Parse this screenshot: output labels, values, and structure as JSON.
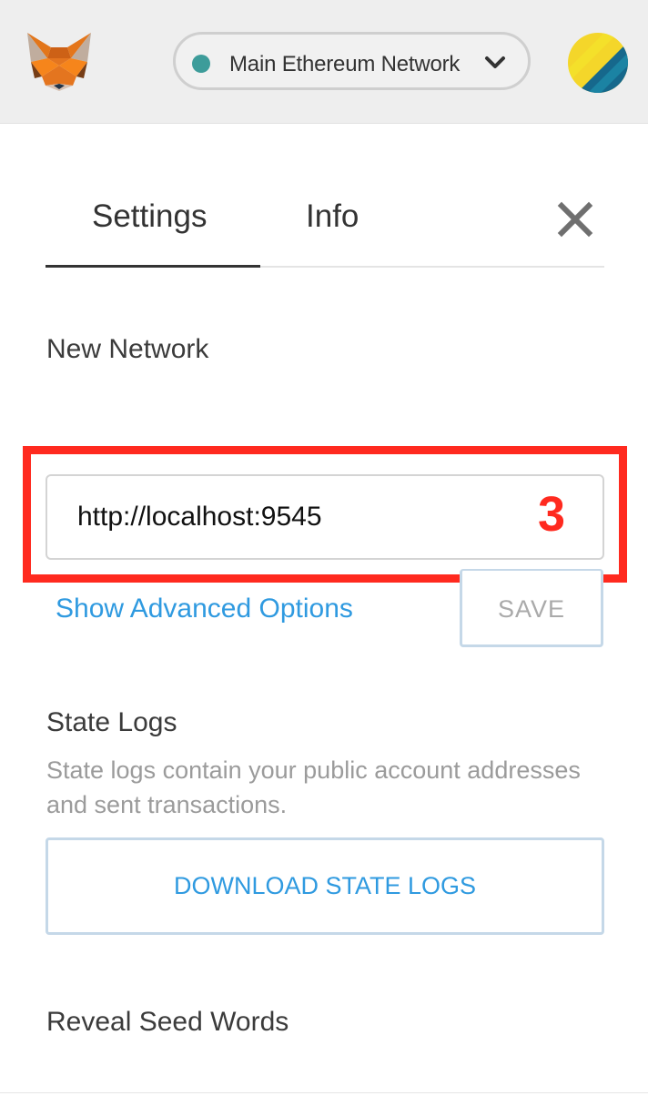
{
  "header": {
    "network_label": "Main Ethereum Network",
    "network_status_color": "#3d9c9a",
    "logo_icon": "metamask-fox-icon",
    "avatar_icon": "account-identicon"
  },
  "tabs": [
    {
      "label": "Settings",
      "active": true
    },
    {
      "label": "Info",
      "active": false
    }
  ],
  "close_icon": "close-icon",
  "new_network": {
    "title": "New Network",
    "rpc_value": "http://localhost:9545",
    "annotation_number": "3",
    "annotation_color": "#ff2a1f",
    "advanced_link": "Show Advanced Options",
    "save_label": "SAVE"
  },
  "state_logs": {
    "title": "State Logs",
    "description": "State logs contain your public account addresses and sent transactions.",
    "download_label": "DOWNLOAD STATE LOGS"
  },
  "reveal_seed": {
    "title": "Reveal Seed Words"
  },
  "colors": {
    "accent_blue": "#2f9ae0",
    "header_bg": "#eeeeee"
  }
}
